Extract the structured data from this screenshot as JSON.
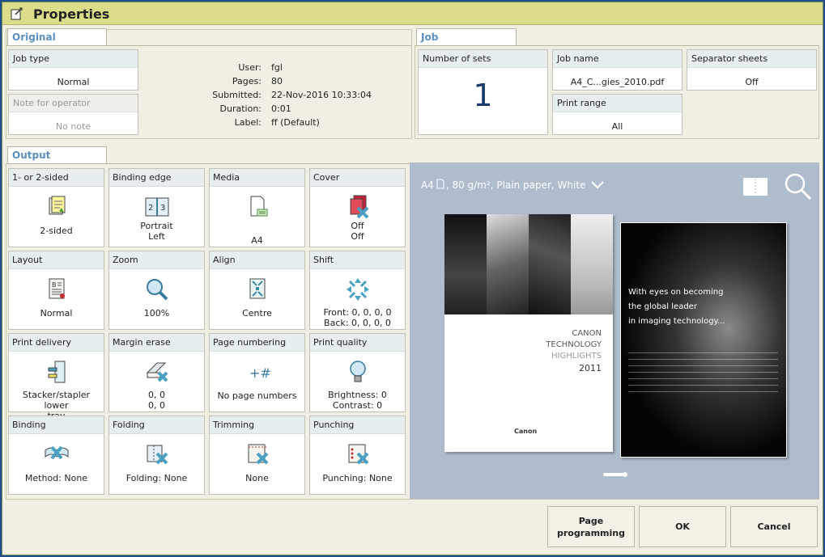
{
  "window": {
    "title": "Properties"
  },
  "original": {
    "tab": "Original",
    "job_type": {
      "label": "Job type",
      "value": "Normal"
    },
    "note": {
      "label": "Note for operator",
      "value": "No note"
    },
    "info": [
      {
        "label": "User:",
        "value": "fgl"
      },
      {
        "label": "Pages:",
        "value": "80"
      },
      {
        "label": "Submitted:",
        "value": "22-Nov-2016 10:33:04"
      },
      {
        "label": "Duration:",
        "value": "0:01"
      },
      {
        "label": "Label:",
        "value": "ff (Default)"
      }
    ]
  },
  "job": {
    "tab": "Job",
    "number_of_sets": {
      "label": "Number of sets",
      "value": "1"
    },
    "job_name": {
      "label": "Job name",
      "value": "A4_C...gies_2010.pdf"
    },
    "separator": {
      "label": "Separator sheets",
      "value": "Off"
    },
    "print_range": {
      "label": "Print range",
      "value": "All"
    }
  },
  "output": {
    "tab": "Output",
    "tiles": [
      {
        "label": "1- or 2-sided",
        "value": "2-sided",
        "icon": "two-sided-icon"
      },
      {
        "label": "Binding edge",
        "value": "Portrait\nLeft",
        "icon": "binding-edge-icon"
      },
      {
        "label": "Media",
        "value": "A4",
        "icon": "media-icon"
      },
      {
        "label": "Cover",
        "value": "Off\nOff",
        "icon": "cover-icon"
      },
      {
        "label": "Layout",
        "value": "Normal",
        "icon": "layout-icon"
      },
      {
        "label": "Zoom",
        "value": "100%",
        "icon": "zoom-icon"
      },
      {
        "label": "Align",
        "value": "Centre",
        "icon": "align-icon"
      },
      {
        "label": "Shift",
        "value": "Front: 0, 0, 0, 0\nBack: 0, 0, 0, 0",
        "icon": "shift-icon"
      },
      {
        "label": "Print delivery",
        "value": "Stacker/stapler lower\ntray",
        "icon": "print-delivery-icon"
      },
      {
        "label": "Margin erase",
        "value": "0, 0\n0, 0",
        "icon": "margin-erase-icon"
      },
      {
        "label": "Page numbering",
        "value": "No page numbers",
        "icon": "page-numbering-icon"
      },
      {
        "label": "Print quality",
        "value": "Brightness: 0\nContrast: 0",
        "icon": "print-quality-icon"
      },
      {
        "label": "Binding",
        "value": "Method: None",
        "icon": "binding-icon"
      },
      {
        "label": "Folding",
        "value": "Folding: None",
        "icon": "folding-icon"
      },
      {
        "label": "Trimming",
        "value": "None",
        "icon": "trimming-icon"
      },
      {
        "label": "Punching",
        "value": "Punching: None",
        "icon": "punching-icon"
      }
    ]
  },
  "preview": {
    "media_size": "A4",
    "media_desc": ", 80 g/m², Plain paper, White",
    "front_page": {
      "line1": "CANON",
      "line2": "TECHNOLOGY",
      "line3": "HIGHLIGHTS",
      "line4": "2011",
      "logo": "Canon"
    },
    "back_page": {
      "line1": "With eyes on becoming",
      "line2": "the global leader",
      "line3": "in imaging technology..."
    }
  },
  "buttons": {
    "page_programming": "Page\nprogramming",
    "ok": "OK",
    "cancel": "Cancel"
  }
}
